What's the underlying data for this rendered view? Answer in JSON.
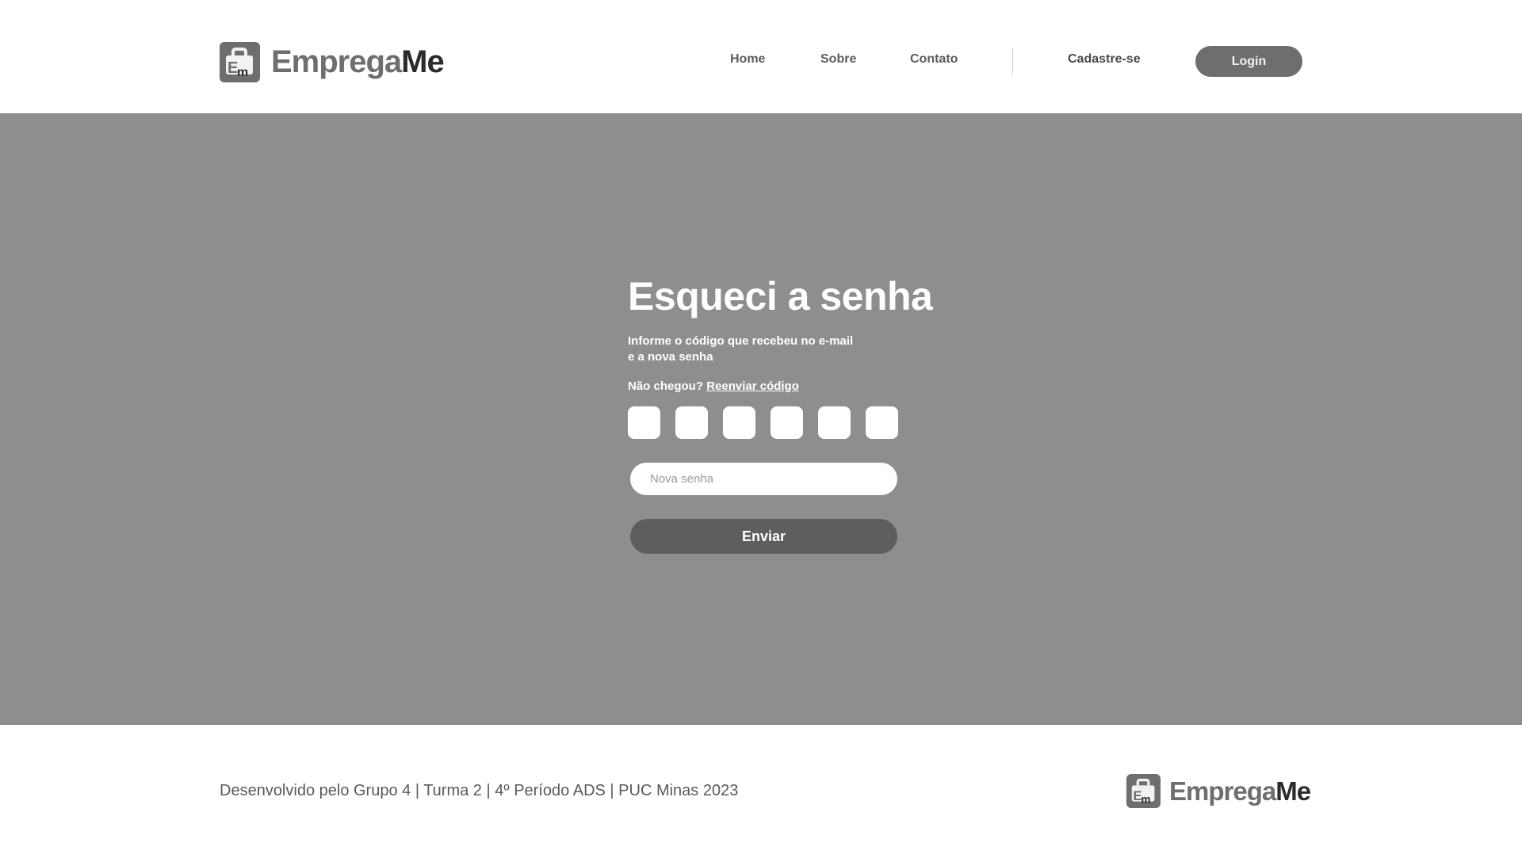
{
  "header": {
    "logo": {
      "part1": "Emprega",
      "part2": "Me",
      "icon": "briefcase-em-icon"
    },
    "nav": {
      "home": "Home",
      "sobre": "Sobre",
      "contato": "Contato",
      "cadastro": "Cadastre-se"
    },
    "login_label": "Login"
  },
  "form": {
    "title": "Esqueci a senha",
    "subtitle_line1": "Informe o código que recebeu no e-mail",
    "subtitle_line2": "e a nova senha",
    "resend_prefix": "Não chegou?",
    "resend_link": "Reenviar código",
    "code_digits": [
      "",
      "",
      "",
      "",
      "",
      ""
    ],
    "password_placeholder": "Nova senha",
    "submit_label": "Enviar"
  },
  "footer": {
    "text": "Desenvolvido pelo Grupo 4 | Turma 2 | 4º Período ADS | PUC Minas 2023",
    "logo": {
      "part1": "Emprega",
      "part2": "Me"
    }
  },
  "colors": {
    "hero_bg": "#8e8e8e",
    "button_dark": "#5e5e5e",
    "login_bg": "#6e6e6e",
    "logo_grey": "#6e6e6e",
    "logo_dark": "#2b2b2b"
  }
}
